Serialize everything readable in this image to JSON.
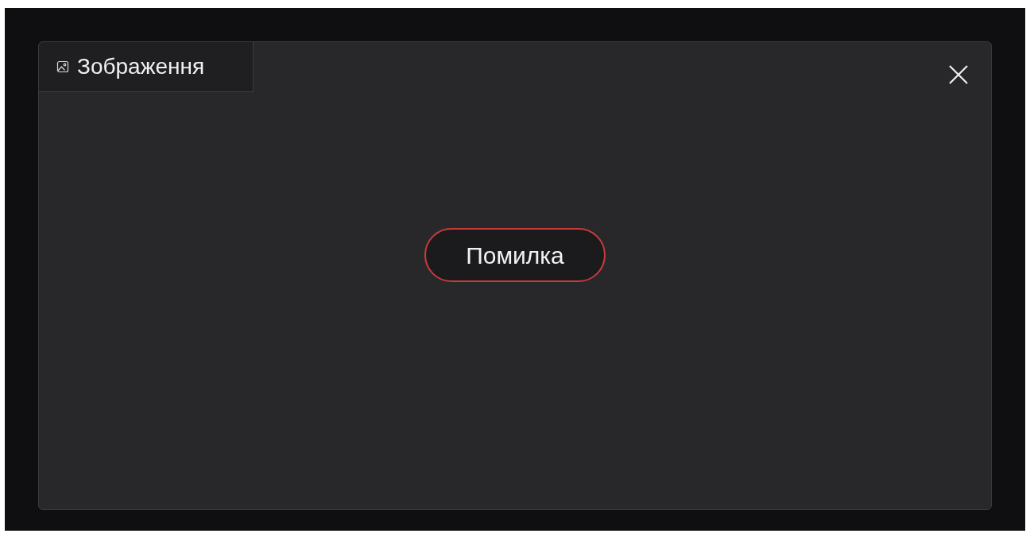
{
  "panel": {
    "tab": {
      "label": "Зображення"
    }
  },
  "error": {
    "label": "Помилка"
  }
}
